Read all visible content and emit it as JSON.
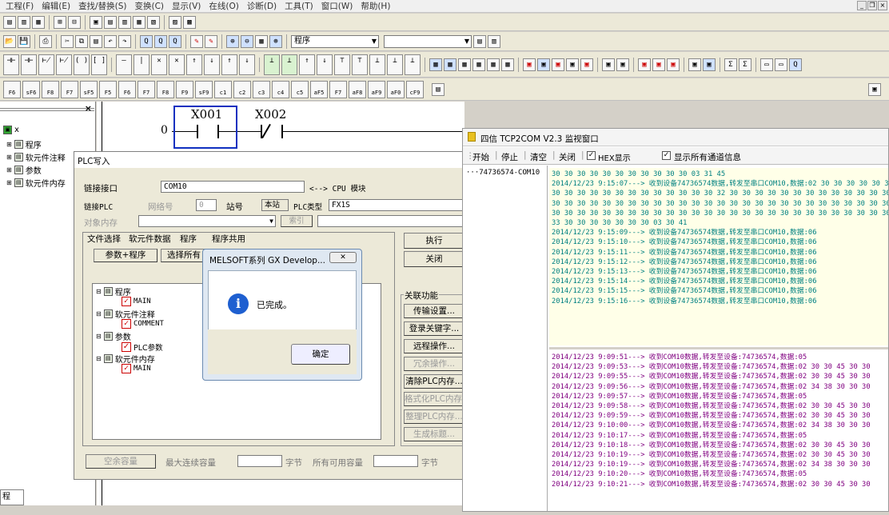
{
  "menu": [
    "工程(F)",
    "编辑(E)",
    "查找/替换(S)",
    "变换(C)",
    "显示(V)",
    "在线(O)",
    "诊断(D)",
    "工具(T)",
    "窗口(W)",
    "帮助(H)"
  ],
  "toolbar": {
    "program_combo": "程序",
    "blank_combo": "",
    "row4": [
      "F5",
      "F6",
      "sF5",
      "sF6",
      "F7",
      "F8",
      "F9",
      "sF9",
      "cF9",
      "cF10",
      "sF7",
      "sF8",
      "aF7",
      "aF8",
      "aF5",
      "saF5",
      "saF6",
      "saF7",
      "saF8",
      "aF5",
      "caF5",
      "caF10",
      "F10",
      "aF9"
    ],
    "row5": [
      "F6",
      "sF6",
      "F8",
      "F7",
      "sF5",
      "F5",
      "F6",
      "F7",
      "F8",
      "F9",
      "sF9",
      "c1",
      "c2",
      "c3",
      "c4",
      "c5",
      "aF5",
      "F7",
      "aF8",
      "aF9",
      "aF0",
      "cF9"
    ]
  },
  "tree": {
    "root": "x",
    "items": [
      "程序",
      "软元件注释",
      "参数",
      "软元件内存"
    ]
  },
  "ladder": {
    "step": "0",
    "contact1": "X001",
    "contact2": "X002"
  },
  "plc_write": {
    "title": "PLC写入",
    "link_port_label": "链接接口",
    "link_port_value": "COM10",
    "link_arrow": "<--> CPU 模块",
    "link_plc_label": "链接PLC",
    "network_label": "网络号",
    "network_value": "0",
    "station_label": "站号",
    "station_value": "本站",
    "plc_type_label": "PLC类型",
    "plc_type_value": "FX1S",
    "target_mem_label": "对象内存",
    "index_button": "索引",
    "tabs": [
      "文件选择",
      "软元件数据",
      "程序",
      "程序共用"
    ],
    "param_prog_button": "参数+程序",
    "select_all_button": "选择所有",
    "file_tree": [
      "程序",
      "MAIN",
      "软元件注释",
      "COMMENT",
      "参数",
      "PLC参数",
      "软元件内存",
      "MAIN"
    ],
    "execute_button": "执行",
    "close_button": "关闭",
    "related_label": "关联功能",
    "related_buttons": [
      "传输设置...",
      "登录关键字...",
      "远程操作...",
      "冗余操作...",
      "清除PLC内存...",
      "格式化PLC内存...",
      "整理PLC内存...",
      "生成标题..."
    ],
    "free_cap_button": "空余容量",
    "max_cont_label": "最大连续容量",
    "byte1": "字节",
    "all_free_label": "所有可用容量",
    "byte2": "字节"
  },
  "msgbox": {
    "title": "MELSOFT系列 GX Develop...",
    "message": "已完成。",
    "ok": "确定",
    "info_icon": "i"
  },
  "monitor": {
    "title": "四信 TCP2COM V2.3  监视窗口",
    "toolbar": [
      "开始",
      "停止",
      "清空",
      "关闭"
    ],
    "hex_label": "HEX显示",
    "all_channels_label": "显示所有通道信息",
    "channel": "74736574-COM10",
    "upper_log": [
      "30 30 30 30 30 30 30 30 30 30 30 03 31 45",
      "2014/12/23 9:15:07---> 收到设备74736574数据,转发至串口COM10,数据:02 30 30 30 30 30 30 30 30 30 30 30",
      "30 30 30 30 30 30 30 30 30 30 30 30 30 32 30 30 30 30 30 30 30 30 30 30 30 30 30 30",
      "30 30 30 30 30 30 30 30 30 30 30 30 30 30 30 30 30 30 30 30 30 30 30 30 30 30 30 30",
      "30 30 30 30 30 30 30 30 30 30 30 30 30 30 30 30 30 30 30 30 30 30 30 30 30 30 30 30",
      "33 30 30 30 30 30 30 30 03 30 41",
      "2014/12/23 9:15:09---> 收到设备74736574数据,转发至串口COM10,数据:06",
      "2014/12/23 9:15:10---> 收到设备74736574数据,转发至串口COM10,数据:06",
      "2014/12/23 9:15:11---> 收到设备74736574数据,转发至串口COM10,数据:06",
      "2014/12/23 9:15:12---> 收到设备74736574数据,转发至串口COM10,数据:06",
      "2014/12/23 9:15:13---> 收到设备74736574数据,转发至串口COM10,数据:06",
      "2014/12/23 9:15:14---> 收到设备74736574数据,转发至串口COM10,数据:06",
      "2014/12/23 9:15:15---> 收到设备74736574数据,转发至串口COM10,数据:06",
      "2014/12/23 9:15:16---> 收到设备74736574数据,转发至串口COM10,数据:06"
    ],
    "lower_log": [
      "2014/12/23 9:09:51---> 收到COM10数据,转发至设备:74736574,数据:05",
      "2014/12/23 9:09:53---> 收到COM10数据,转发至设备:74736574,数据:02 30 30 45 30 30",
      "2014/12/23 9:09:55---> 收到COM10数据,转发至设备:74736574,数据:02 30 30 45 30 30",
      "2014/12/23 9:09:56---> 收到COM10数据,转发至设备:74736574,数据:02 34 38 30 30 30",
      "2014/12/23 9:09:57---> 收到COM10数据,转发至设备:74736574,数据:05",
      "2014/12/23 9:09:58---> 收到COM10数据,转发至设备:74736574,数据:02 30 30 45 30 30",
      "2014/12/23 9:09:59---> 收到COM10数据,转发至设备:74736574,数据:02 30 30 45 30 30",
      "2014/12/23 9:10:00---> 收到COM10数据,转发至设备:74736574,数据:02 34 38 30 30 30",
      "2014/12/23 9:10:17---> 收到COM10数据,转发至设备:74736574,数据:05",
      "2014/12/23 9:10:18---> 收到COM10数据,转发至设备:74736574,数据:02 30 30 45 30 30",
      "2014/12/23 9:10:19---> 收到COM10数据,转发至设备:74736574,数据:02 30 30 45 30 30",
      "2014/12/23 9:10:19---> 收到COM10数据,转发至设备:74736574,数据:02 34 38 30 30 30",
      "2014/12/23 9:10:20---> 收到COM10数据,转发至设备:74736574,数据:05",
      "2014/12/23 9:10:21---> 收到COM10数据,转发至设备:74736574,数据:02 30 30 45 30 30"
    ]
  },
  "bottom_tab": "程"
}
